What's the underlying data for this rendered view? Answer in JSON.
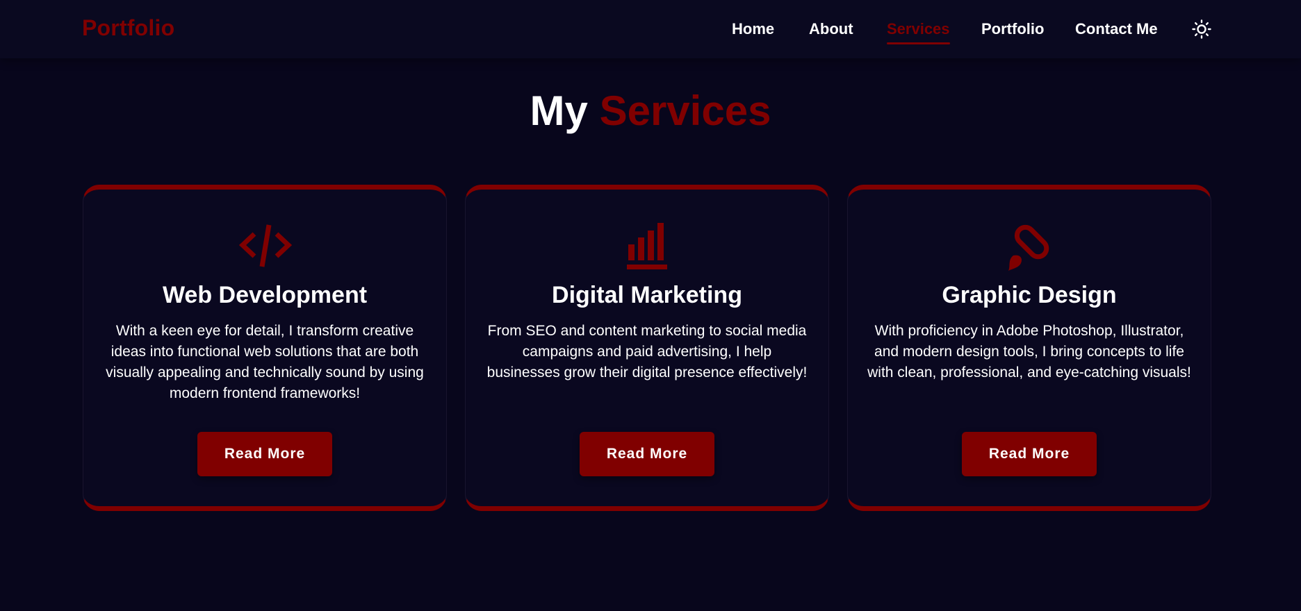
{
  "colors": {
    "accent": "#800000",
    "background": "#08061c",
    "text": "#ffffff"
  },
  "header": {
    "logo": "Portfolio",
    "nav": [
      {
        "label": "Home",
        "active": false
      },
      {
        "label": "About",
        "active": false
      },
      {
        "label": "Services",
        "active": true
      },
      {
        "label": "Portfolio",
        "active": false
      },
      {
        "label": "Contact Me",
        "active": false
      }
    ],
    "theme_toggle_icon": "sun-icon"
  },
  "section": {
    "title_prefix": "My",
    "title_accent": "Services"
  },
  "cards": [
    {
      "icon": "code-icon",
      "title": "Web Development",
      "description": "With a keen eye for detail, I transform creative ideas into functional web solutions that are both visually appealing and technically sound by using modern frontend frameworks!",
      "button": "Read More"
    },
    {
      "icon": "bar-chart-icon",
      "title": "Digital Marketing",
      "description": "From SEO and content marketing to social media campaigns and paid advertising, I help businesses grow their digital presence effectively!",
      "button": "Read More"
    },
    {
      "icon": "paintbrush-icon",
      "title": "Graphic Design",
      "description": "With proficiency in Adobe Photoshop, Illustrator, and modern design tools, I bring concepts to life with clean, professional, and eye-catching visuals!",
      "button": "Read More"
    }
  ]
}
